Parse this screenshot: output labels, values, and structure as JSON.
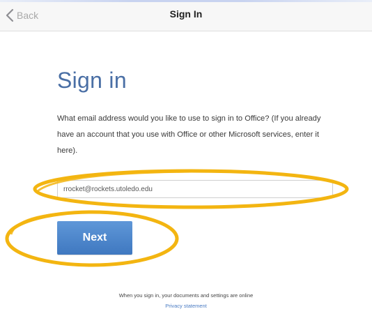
{
  "navbar": {
    "back_label": "Back",
    "back_icon": "chevron-left-icon",
    "title": "Sign In"
  },
  "content": {
    "heading": "Sign in",
    "description": "What email address would you like to use to sign in to Office? (If you already have an account that you use with Office or other Microsoft services, enter it here).",
    "email_value": "rrocket@rockets.utoledo.edu",
    "next_label": "Next"
  },
  "footer": {
    "note": "When you sign in, your documents and settings are online",
    "privacy_label": "Privacy statement"
  },
  "colors": {
    "title": "#4a6fa5",
    "button": "#4a84c9",
    "annotation": "#f3b511",
    "link": "#4a7bc3"
  }
}
